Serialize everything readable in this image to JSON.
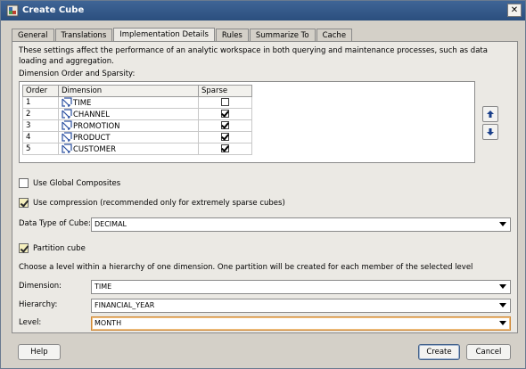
{
  "window": {
    "title": "Create Cube"
  },
  "tabs": [
    "General",
    "Translations",
    "Implementation Details",
    "Rules",
    "Summarize To",
    "Cache"
  ],
  "active_tab": "Implementation Details",
  "description": "These settings affect the performance of an analytic workspace in both querying and maintenance processes, such as data loading and aggregation.",
  "dimension_order": {
    "label": "Dimension Order and Sparsity:",
    "columns": [
      "Order",
      "Dimension",
      "Sparse"
    ],
    "rows": [
      {
        "order": "1",
        "dimension": "TIME",
        "sparse": false
      },
      {
        "order": "2",
        "dimension": "CHANNEL",
        "sparse": true
      },
      {
        "order": "3",
        "dimension": "PROMOTION",
        "sparse": true
      },
      {
        "order": "4",
        "dimension": "PRODUCT",
        "sparse": true
      },
      {
        "order": "5",
        "dimension": "CUSTOMER",
        "sparse": true
      }
    ]
  },
  "options": {
    "global_composites": {
      "label": "Use Global Composites",
      "checked": false
    },
    "compression": {
      "label": "Use compression (recommended only for extremely sparse cubes)",
      "checked": true
    }
  },
  "data_type": {
    "label": "Data Type of Cube:",
    "value": "DECIMAL"
  },
  "partition": {
    "label": "Partition cube",
    "checked": true,
    "help": "Choose a level within a hierarchy of one dimension. One partition will be created for each member of the selected level",
    "dimension": {
      "label": "Dimension:",
      "value": "TIME"
    },
    "hierarchy": {
      "label": "Hierarchy:",
      "value": "FINANCIAL_YEAR"
    },
    "level": {
      "label": "Level:",
      "value": "MONTH"
    }
  },
  "buttons": {
    "help": "Help",
    "create": "Create",
    "cancel": "Cancel"
  },
  "colors": {
    "titlebar": "#2b4f7e",
    "panel": "#ebe9e4",
    "window": "#d4d0c8",
    "focus_border": "#d08a3a",
    "checkbox_checked_fill": "#f5efbe"
  }
}
